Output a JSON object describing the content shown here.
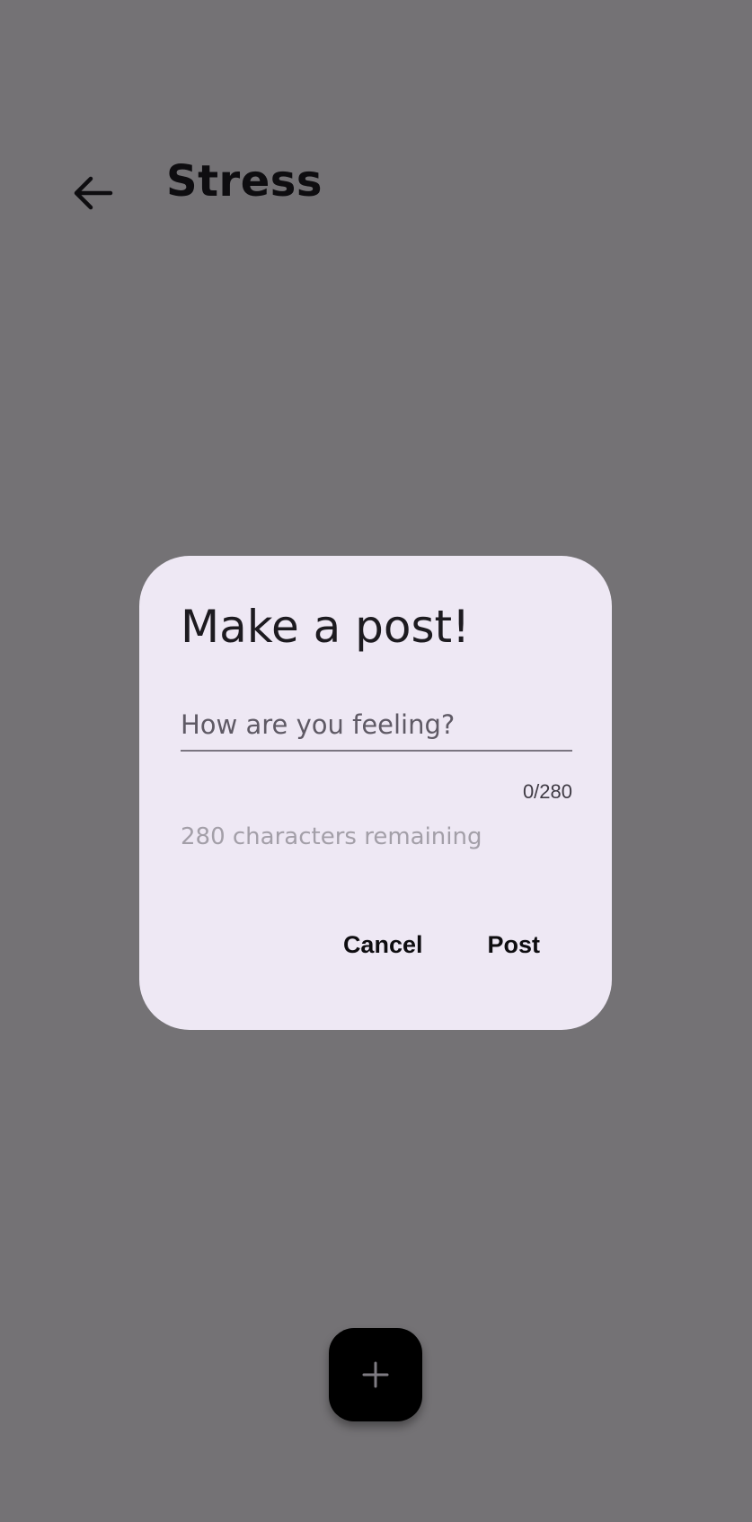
{
  "header": {
    "title": "Stress",
    "back_icon": "arrow-back-icon"
  },
  "dialog": {
    "title": "Make a post!",
    "input": {
      "placeholder": "How are you feeling?",
      "value": ""
    },
    "counter": "0/280",
    "remaining_text": "280 characters remaining",
    "cancel_label": "Cancel",
    "post_label": "Post"
  },
  "fab": {
    "icon": "plus-icon"
  },
  "colors": {
    "background_scrim": "#747275",
    "dialog_surface": "#eee8f4",
    "text_primary": "#1d1b20",
    "fab": "#000000"
  }
}
